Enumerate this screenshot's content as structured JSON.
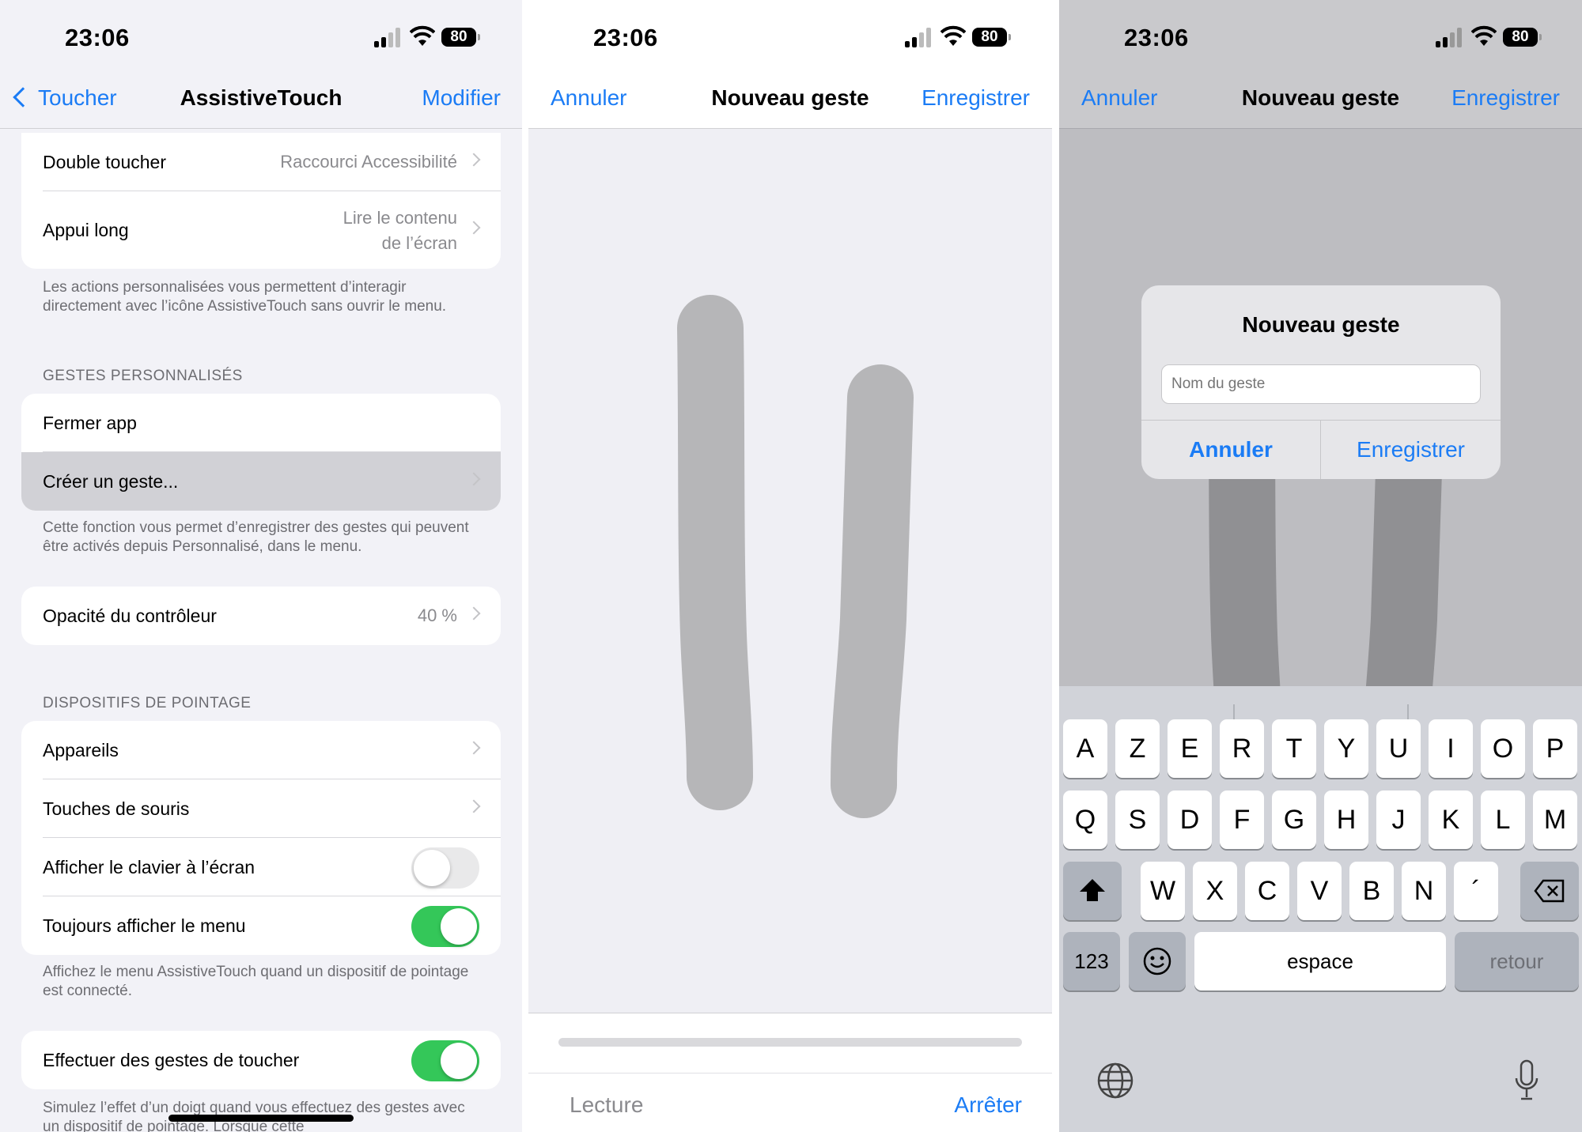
{
  "status": {
    "time": "23:06",
    "battery": "80"
  },
  "panel1": {
    "nav": {
      "back_label": "Toucher",
      "title": "AssistiveTouch",
      "action_label": "Modifier"
    },
    "actions_group": [
      {
        "label": "Double toucher",
        "value": "Raccourci Accessibilité"
      },
      {
        "label": "Appui long",
        "value_line1": "Lire le contenu",
        "value_line2": "de l’écran"
      }
    ],
    "actions_footer": "Les actions personnalisées vous permettent d’interagir directement avec l’icône AssistiveTouch sans ouvrir le menu.",
    "custom_gestures": {
      "header": "GESTES PERSONNALISÉS",
      "items": [
        "Fermer app",
        "Créer un geste..."
      ],
      "footer": "Cette fonction vous permet d’enregistrer des gestes qui peuvent être activés depuis Personnalisé, dans le menu."
    },
    "opacity": {
      "label": "Opacité du contrôleur",
      "value": "40 %"
    },
    "pointer": {
      "header": "DISPOSITIFS DE POINTAGE",
      "items": [
        {
          "label": "Appareils",
          "type": "chevron"
        },
        {
          "label": "Touches de souris",
          "type": "chevron"
        },
        {
          "label": "Afficher le clavier à l’écran",
          "type": "toggle",
          "on": false
        },
        {
          "label": "Toujours afficher le menu",
          "type": "toggle",
          "on": true
        }
      ],
      "footer": "Affichez le menu AssistiveTouch quand un dispositif de pointage est connecté."
    },
    "touch_gestures": {
      "label": "Effectuer des gestes de toucher",
      "on": true,
      "footer": "Simulez l’effet d’un doigt quand vous effectuez des gestes avec un dispositif de pointage. Lorsque cette"
    }
  },
  "panel2": {
    "nav": {
      "cancel_label": "Annuler",
      "title": "Nouveau geste",
      "save_label": "Enregistrer"
    },
    "bottom": {
      "play_label": "Lecture",
      "stop_label": "Arrêter"
    }
  },
  "panel3": {
    "nav": {
      "cancel_label": "Annuler",
      "title": "Nouveau geste",
      "save_label": "Enregistrer"
    },
    "alert": {
      "title": "Nouveau geste",
      "placeholder": "Nom du geste",
      "cancel_label": "Annuler",
      "save_label": "Enregistrer"
    },
    "keyboard": {
      "row1": [
        "A",
        "Z",
        "E",
        "R",
        "T",
        "Y",
        "U",
        "I",
        "O",
        "P"
      ],
      "row2": [
        "Q",
        "S",
        "D",
        "F",
        "G",
        "H",
        "J",
        "K",
        "L",
        "M"
      ],
      "row3": [
        "W",
        "X",
        "C",
        "V",
        "B",
        "N",
        "´"
      ],
      "numbers_label": "123",
      "space_label": "espace",
      "return_label": "retour"
    }
  },
  "colors": {
    "accent": "#1b7cf5",
    "toggle_on": "#34c759",
    "gesture_stroke": "#b6b6b8"
  }
}
